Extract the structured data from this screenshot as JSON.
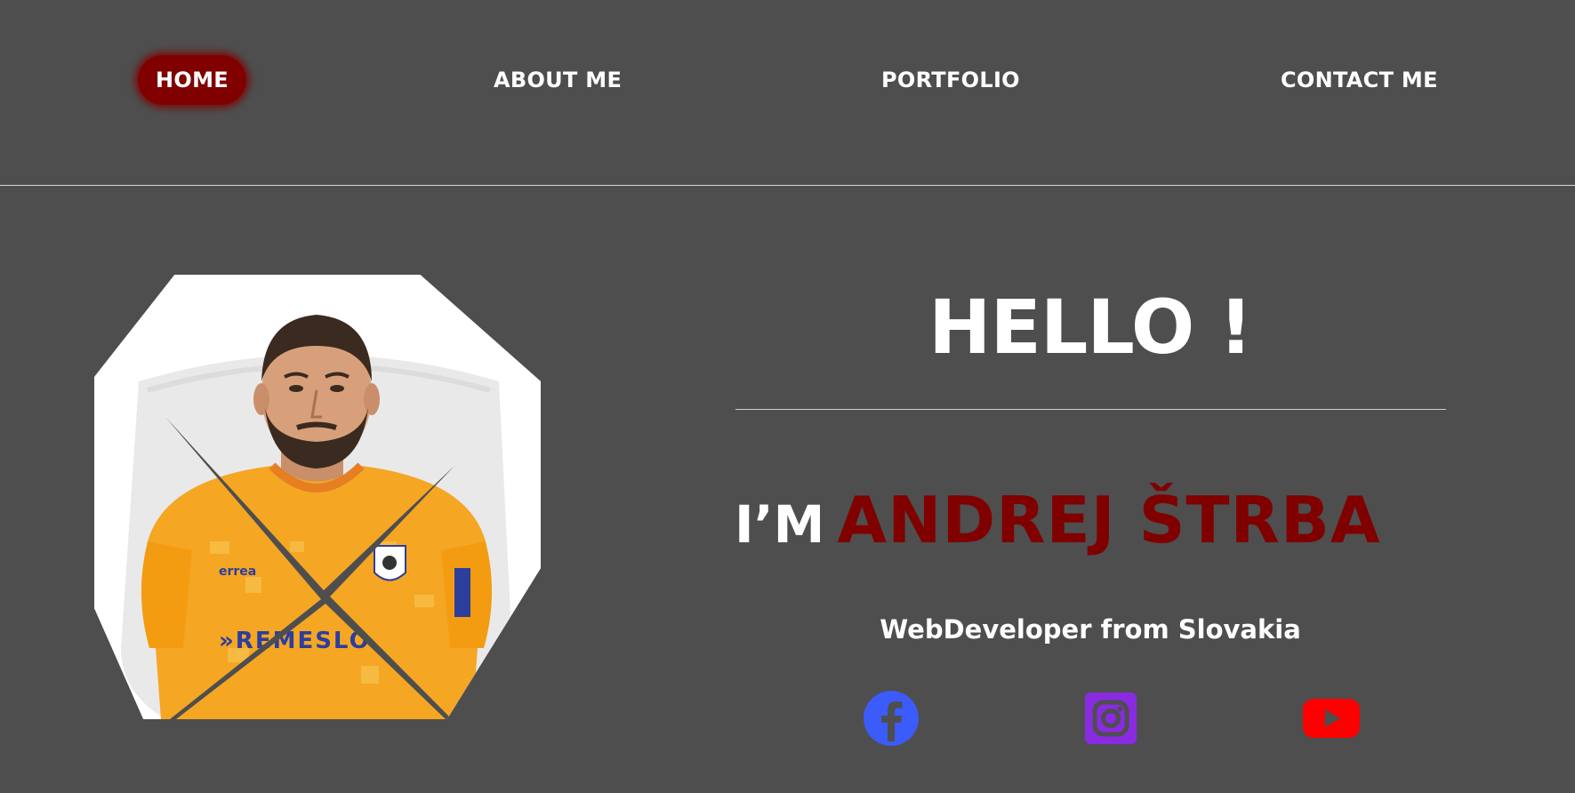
{
  "nav": {
    "items": [
      {
        "label": "HOME",
        "active": true
      },
      {
        "label": "ABOUT ME",
        "active": false
      },
      {
        "label": "PORTFOLIO",
        "active": false
      },
      {
        "label": "CONTACT ME",
        "active": false
      }
    ]
  },
  "hero": {
    "greeting": "HELLO !",
    "intro_prefix": "I’M",
    "name": "ANDREJ ŠTRBA",
    "subtitle": "WebDeveloper from Slovakia"
  },
  "portrait": {
    "jersey_brand": "errea",
    "jersey_sponsor": "REMESLO"
  },
  "social": [
    {
      "name": "facebook-icon",
      "color": "#3b5bfb"
    },
    {
      "name": "instagram-icon",
      "color": "#8a2be2"
    },
    {
      "name": "youtube-icon",
      "color": "#ff0000"
    }
  ],
  "colors": {
    "background": "#4e4e4e",
    "accent": "#800000",
    "text": "#ffffff"
  }
}
